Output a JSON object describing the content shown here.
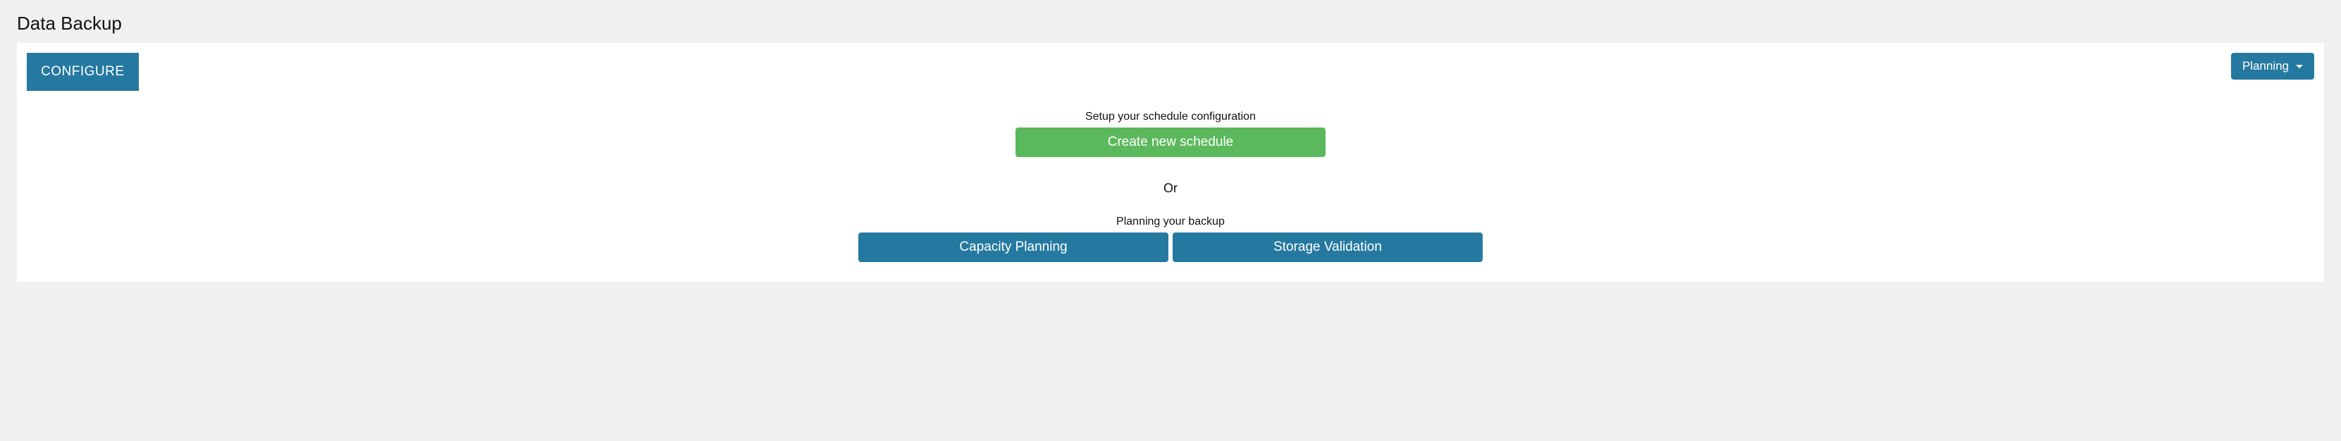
{
  "header": {
    "title": "Data Backup"
  },
  "toolbar": {
    "configure_label": "CONFIGURE",
    "planning_dropdown_label": "Planning"
  },
  "main": {
    "schedule_helper": "Setup your schedule configuration",
    "create_schedule_label": "Create new schedule",
    "or_label": "Or",
    "planning_helper": "Planning your backup",
    "capacity_planning_label": "Capacity Planning",
    "storage_validation_label": "Storage Validation"
  }
}
